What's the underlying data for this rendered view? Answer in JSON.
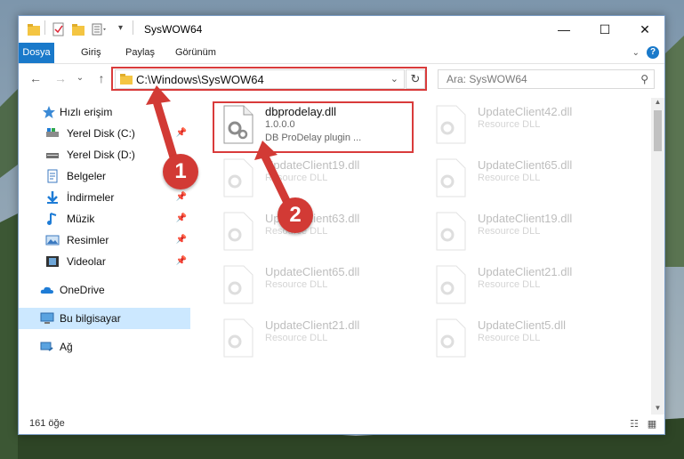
{
  "window": {
    "title": "SysWOW64",
    "controls": {
      "minimize": "—",
      "maximize": "☐",
      "close": "✕"
    }
  },
  "ribbon": {
    "tabs": [
      {
        "label": "Dosya",
        "active": true
      },
      {
        "label": "Giriş",
        "active": false
      },
      {
        "label": "Paylaş",
        "active": false
      },
      {
        "label": "Görünüm",
        "active": false
      }
    ],
    "help": "?"
  },
  "address": {
    "path": "C:\\Windows\\SysWOW64",
    "search_placeholder": "Ara: SysWOW64"
  },
  "nav": {
    "items": [
      {
        "label": "Hızlı erişim",
        "icon": "star-icon",
        "pinned": false
      },
      {
        "label": "Yerel Disk (C:)",
        "icon": "drive-icon",
        "pinned": true
      },
      {
        "label": "Yerel Disk (D:)",
        "icon": "drive-icon",
        "pinned": false
      },
      {
        "label": "Belgeler",
        "icon": "documents-icon",
        "pinned": true
      },
      {
        "label": "İndirmeler",
        "icon": "download-icon",
        "pinned": true
      },
      {
        "label": "Müzik",
        "icon": "music-icon",
        "pinned": true
      },
      {
        "label": "Resimler",
        "icon": "pictures-icon",
        "pinned": true
      },
      {
        "label": "Videolar",
        "icon": "video-icon",
        "pinned": true
      },
      {
        "label": "OneDrive",
        "icon": "cloud-icon",
        "pinned": false
      },
      {
        "label": "Bu bilgisayar",
        "icon": "computer-icon",
        "pinned": false,
        "selected": true
      },
      {
        "label": "Ağ",
        "icon": "network-icon",
        "pinned": false
      }
    ]
  },
  "files": [
    {
      "name": "dbprodelay.dll",
      "version": "1.0.0.0",
      "desc": "DB ProDelay plugin ..."
    },
    {
      "name": "UpdateClient42.dll",
      "desc": "Resource DLL"
    },
    {
      "name": "UpdateClient19.dll",
      "desc": "Resource DLL"
    },
    {
      "name": "UpdateClient65.dll",
      "desc": "Resource DLL"
    },
    {
      "name": "UpdateClient63.dll",
      "desc": "Resource DLL"
    },
    {
      "name": "UpdateClient19.dll",
      "desc": "Resource DLL"
    },
    {
      "name": "UpdateClient65.dll",
      "desc": "Resource DLL"
    },
    {
      "name": "UpdateClient21.dll",
      "desc": "Resource DLL"
    },
    {
      "name": "UpdateClient21.dll",
      "desc": "Resource DLL"
    },
    {
      "name": "UpdateClient5.dll",
      "desc": "Resource DLL"
    }
  ],
  "status": {
    "count": "161 öğe"
  },
  "annotations": {
    "step1": "1",
    "step2": "2"
  },
  "colors": {
    "accent": "#1979ca",
    "annotation": "#d93b3b",
    "selected": "#cce8ff"
  }
}
